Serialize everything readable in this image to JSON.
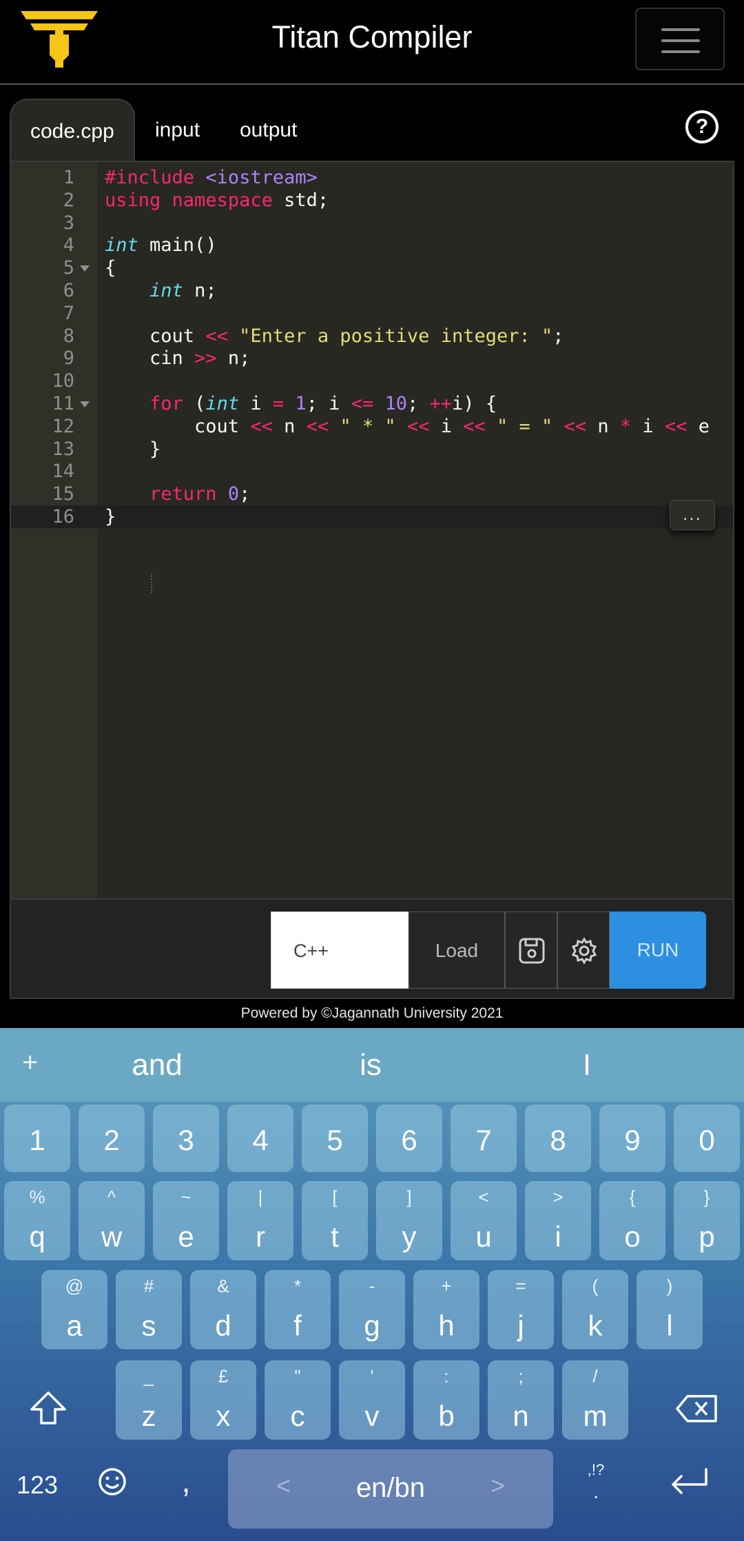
{
  "header": {
    "title": "Titan Compiler",
    "logo_icon": "titan-logo-icon",
    "menu_icon": "hamburger-menu-icon"
  },
  "tabs": [
    {
      "label": "code.cpp",
      "active": true
    },
    {
      "label": "input",
      "active": false
    },
    {
      "label": "output",
      "active": false
    }
  ],
  "help_label": "?",
  "editor": {
    "language": "cpp",
    "lines": [
      {
        "n": "1",
        "text": "#include <iostream>"
      },
      {
        "n": "2",
        "text": "using namespace std;"
      },
      {
        "n": "3",
        "text": ""
      },
      {
        "n": "4",
        "text": "int main()"
      },
      {
        "n": "5",
        "text": "{"
      },
      {
        "n": "6",
        "text": "    int n;"
      },
      {
        "n": "7",
        "text": ""
      },
      {
        "n": "8",
        "text": "    cout << \"Enter a positive integer: \";"
      },
      {
        "n": "9",
        "text": "    cin >> n;"
      },
      {
        "n": "10",
        "text": ""
      },
      {
        "n": "11",
        "text": "    for (int i = 1; i <= 10; ++i) {"
      },
      {
        "n": "12",
        "text": "        cout << n << \" * \" << i << \" = \" << n * i << e"
      },
      {
        "n": "13",
        "text": "    }"
      },
      {
        "n": "14",
        "text": ""
      },
      {
        "n": "15",
        "text": "    return 0;"
      },
      {
        "n": "16",
        "text": "}"
      }
    ],
    "fold_lines": [
      "5",
      "11"
    ],
    "active_line": "16",
    "more_label": "..."
  },
  "toolbar": {
    "language_value": "C++",
    "load_label": "Load",
    "save_icon": "save-icon",
    "settings_icon": "gear-icon",
    "run_label": "RUN"
  },
  "footer": {
    "text": "Powered by ©Jagannath University 2021"
  },
  "keyboard": {
    "suggestions": [
      "and",
      "is",
      "I"
    ],
    "number_row": [
      "1",
      "2",
      "3",
      "4",
      "5",
      "6",
      "7",
      "8",
      "9",
      "0"
    ],
    "row1": [
      {
        "main": "q",
        "sub": "%"
      },
      {
        "main": "w",
        "sub": "^"
      },
      {
        "main": "e",
        "sub": "~"
      },
      {
        "main": "r",
        "sub": "|"
      },
      {
        "main": "t",
        "sub": "["
      },
      {
        "main": "y",
        "sub": "]"
      },
      {
        "main": "u",
        "sub": "<"
      },
      {
        "main": "i",
        "sub": ">"
      },
      {
        "main": "o",
        "sub": "{"
      },
      {
        "main": "p",
        "sub": "}"
      }
    ],
    "row2": [
      {
        "main": "a",
        "sub": "@"
      },
      {
        "main": "s",
        "sub": "#"
      },
      {
        "main": "d",
        "sub": "&"
      },
      {
        "main": "f",
        "sub": "*"
      },
      {
        "main": "g",
        "sub": "-"
      },
      {
        "main": "h",
        "sub": "+"
      },
      {
        "main": "j",
        "sub": "="
      },
      {
        "main": "k",
        "sub": "("
      },
      {
        "main": "l",
        "sub": ")"
      }
    ],
    "row3": [
      {
        "main": "z",
        "sub": "_"
      },
      {
        "main": "x",
        "sub": "£"
      },
      {
        "main": "c",
        "sub": "\""
      },
      {
        "main": "v",
        "sub": "'"
      },
      {
        "main": "b",
        "sub": ":"
      },
      {
        "main": "n",
        "sub": ";"
      },
      {
        "main": "m",
        "sub": "/"
      }
    ],
    "bottom": {
      "numbers_label": "123",
      "emoji_icon": "emoji-icon",
      "comma": ",",
      "space_label": "en/bn",
      "punct_top": ",!?",
      "punct_main": ".",
      "enter_icon": "enter-icon",
      "shift_icon": "shift-icon",
      "backspace_icon": "backspace-icon"
    }
  }
}
